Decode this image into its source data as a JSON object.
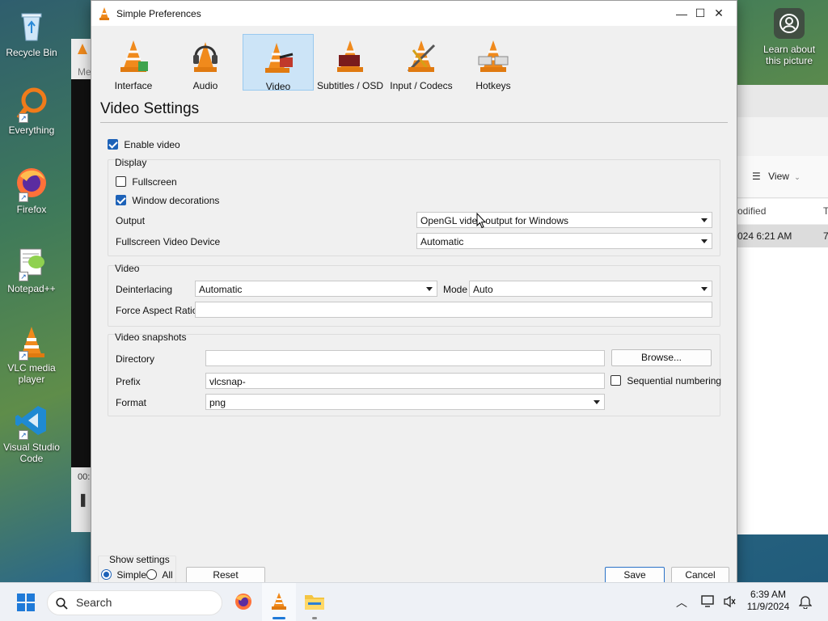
{
  "desktop": {
    "icons": [
      "Recycle Bin",
      "Everything",
      "Firefox",
      "Notepad++",
      "VLC media player",
      "Visual Studio Code"
    ],
    "learn_label": "Learn about this picture"
  },
  "explorer": {
    "view_label": "View",
    "col_modified": "odified",
    "col_type": "T",
    "row_date": "024 6:21 AM",
    "row_extra": "7"
  },
  "bg_vlc": {
    "menu_fragment": "Me",
    "time_fragment": "00:"
  },
  "window": {
    "title": "Simple Preferences",
    "minimize": "—",
    "maximize": "☐",
    "close": "✕"
  },
  "tabs": [
    {
      "label": "Interface"
    },
    {
      "label": "Audio"
    },
    {
      "label": "Video",
      "selected": true
    },
    {
      "label": "Subtitles / OSD"
    },
    {
      "label": "Input / Codecs"
    },
    {
      "label": "Hotkeys"
    }
  ],
  "page": {
    "heading": "Video Settings"
  },
  "video": {
    "enable_video": {
      "label": "Enable video",
      "checked": true
    },
    "display": {
      "title": "Display",
      "fullscreen": {
        "label": "Fullscreen",
        "checked": false
      },
      "window_decorations": {
        "label": "Window decorations",
        "checked": true
      },
      "output_label": "Output",
      "output_value": "OpenGL video output for Windows",
      "fs_device_label": "Fullscreen Video Device",
      "fs_device_value": "Automatic"
    },
    "video_group": {
      "title": "Video",
      "deinterlacing_label": "Deinterlacing",
      "deinterlacing_value": "Automatic",
      "mode_label": "Mode",
      "mode_value": "Auto",
      "aspect_label": "Force Aspect Ratio",
      "aspect_value": ""
    },
    "snapshots": {
      "title": "Video snapshots",
      "directory_label": "Directory",
      "directory_value": "",
      "browse_label": "Browse...",
      "prefix_label": "Prefix",
      "prefix_value": "vlcsnap-",
      "sequential_label": "Sequential numbering",
      "sequential_checked": false,
      "format_label": "Format",
      "format_value": "png"
    }
  },
  "footer": {
    "show_settings": "Show settings",
    "simple": "Simple",
    "all": "All",
    "reset": "Reset Preferences",
    "save": "Save",
    "cancel": "Cancel"
  },
  "taskbar": {
    "search_placeholder": "Search",
    "time": "6:39 AM",
    "date": "11/9/2024"
  }
}
